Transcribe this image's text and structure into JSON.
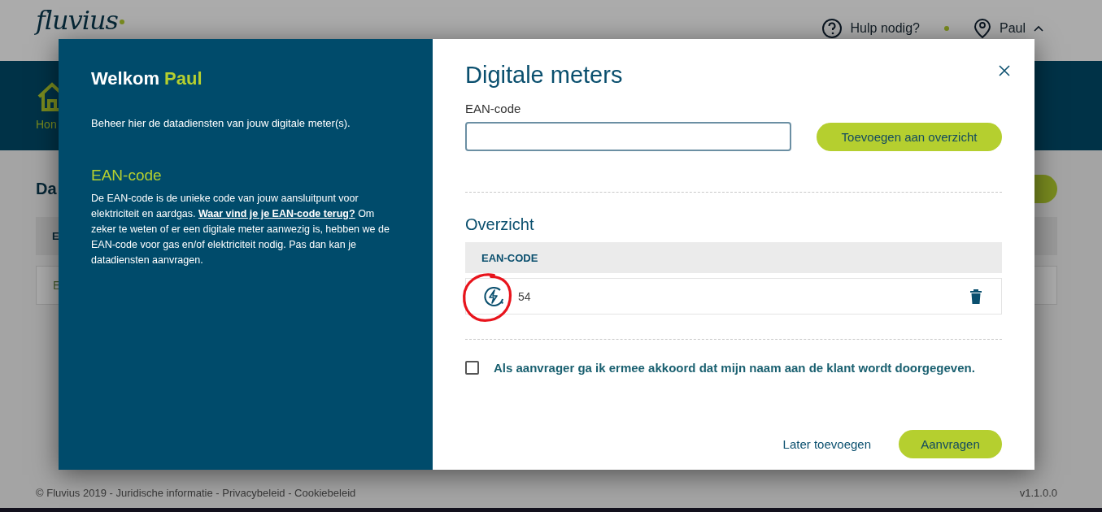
{
  "header": {
    "logo": "fluvius",
    "help_label": "Hulp nodig?",
    "user_name": "Paul"
  },
  "nav": {
    "items": [
      {
        "label": "Hon"
      }
    ]
  },
  "page": {
    "title": "Da",
    "table_header": "E",
    "table_row": "E"
  },
  "footer": {
    "text": "© Fluvius 2019 - Juridische informatie - Privacybeleid - Cookiebeleid",
    "version": "v1.1.0.0"
  },
  "dialog": {
    "intro": {
      "greeting": "Welkom",
      "name": "Paul",
      "text": "Beheer hier de datadiensten van jouw digitale meter(s).",
      "heading": "EAN-code",
      "before": "De EAN-code is de unieke code van jouw aansluitpunt voor elektriciteit en aardgas. ",
      "link": "Waar vind je je EAN-code terug?",
      "after": " Om zeker te weten of er een digitale meter aanwezig is, hebben we de EAN-code voor gas en/of elektriciteit nodig. Pas dan kan je datadiensten aanvragen."
    },
    "title": "Digitale meters",
    "field_label": "EAN-code",
    "add_button": "Toevoegen aan overzicht",
    "overview_title": "Overzicht",
    "column": "EAN-CODE",
    "rows": [
      {
        "kind": "electricity",
        "code": "54",
        "annotated": true
      }
    ],
    "consent": {
      "checked": false,
      "label": "Als aanvrager ga ik ermee akkoord dat mijn naam aan de klant wordt doorgegeven."
    },
    "later_link": "Later toevoegen",
    "submit_button": "Aanvragen"
  }
}
